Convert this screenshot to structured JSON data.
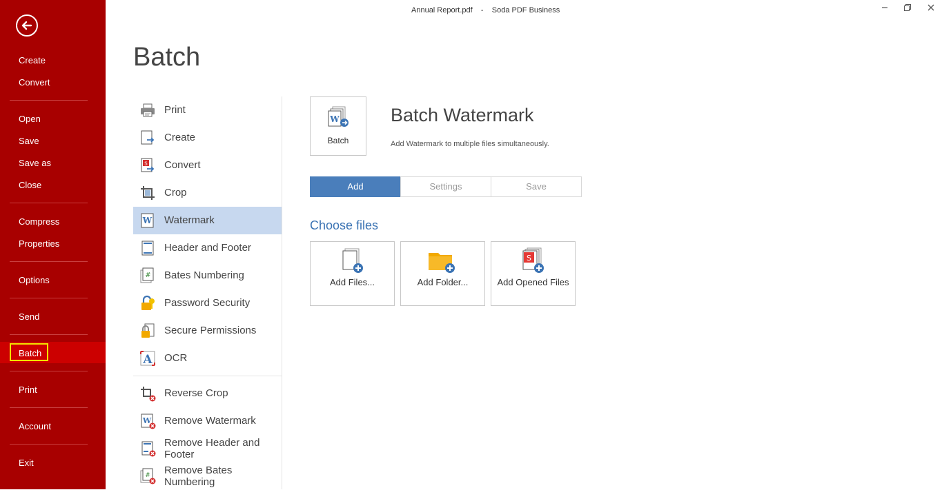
{
  "window": {
    "title": "Annual Report.pdf    -    Soda PDF Business",
    "controls": [
      "minimize",
      "restore",
      "close"
    ]
  },
  "sidebar": {
    "back_icon": "back-arrow-icon",
    "items": [
      {
        "id": "create",
        "label": "Create"
      },
      {
        "id": "convert",
        "label": "Convert"
      },
      {
        "id": "open",
        "label": "Open"
      },
      {
        "id": "save",
        "label": "Save"
      },
      {
        "id": "save_as",
        "label": "Save as"
      },
      {
        "id": "close",
        "label": "Close"
      },
      {
        "id": "compress",
        "label": "Compress"
      },
      {
        "id": "properties",
        "label": "Properties"
      },
      {
        "id": "options",
        "label": "Options"
      },
      {
        "id": "send",
        "label": "Send"
      },
      {
        "id": "batch",
        "label": "Batch",
        "selected": true
      },
      {
        "id": "print",
        "label": "Print"
      },
      {
        "id": "account",
        "label": "Account"
      },
      {
        "id": "exit",
        "label": "Exit"
      }
    ],
    "colors": {
      "background": "#a80000",
      "selected": "#cc0000",
      "highlight_box": "#f2e300"
    }
  },
  "page": {
    "title": "Batch"
  },
  "tools": {
    "items": [
      {
        "label": "Print",
        "icon": "printer-icon"
      },
      {
        "label": "Create",
        "icon": "create-document-icon"
      },
      {
        "label": "Convert",
        "icon": "convert-icon"
      },
      {
        "label": "Crop",
        "icon": "crop-icon"
      },
      {
        "label": "Watermark",
        "icon": "watermark-icon",
        "selected": true
      },
      {
        "label": "Header and Footer",
        "icon": "header-footer-icon"
      },
      {
        "label": "Bates Numbering",
        "icon": "bates-numbering-icon"
      },
      {
        "label": "Password Security",
        "icon": "password-lock-icon"
      },
      {
        "label": "Secure Permissions",
        "icon": "permissions-lock-icon"
      },
      {
        "label": "OCR",
        "icon": "ocr-icon"
      },
      {
        "label": "Reverse Crop",
        "icon": "reverse-crop-icon"
      },
      {
        "label": "Remove Watermark",
        "icon": "remove-watermark-icon"
      },
      {
        "label": "Remove Header and Footer",
        "icon": "remove-header-footer-icon"
      },
      {
        "label": "Remove Bates Numbering",
        "icon": "remove-bates-icon"
      }
    ]
  },
  "panel": {
    "tile_label": "Batch",
    "title": "Batch Watermark",
    "description": "Add Watermark to multiple files simultaneously.",
    "steps": [
      {
        "label": "Add",
        "active": true
      },
      {
        "label": "Settings",
        "active": false
      },
      {
        "label": "Save",
        "active": false
      }
    ],
    "choose_files_title": "Choose files",
    "file_buttons": [
      {
        "label": "Add Files...",
        "icon": "add-files-icon"
      },
      {
        "label": "Add Folder...",
        "icon": "add-folder-icon"
      },
      {
        "label": "Add Opened Files",
        "icon": "add-opened-files-icon"
      }
    ],
    "colors": {
      "accent": "#4a7ebb",
      "heading_blue": "#3c74b4",
      "tool_selected": "#c7d8ef"
    }
  }
}
